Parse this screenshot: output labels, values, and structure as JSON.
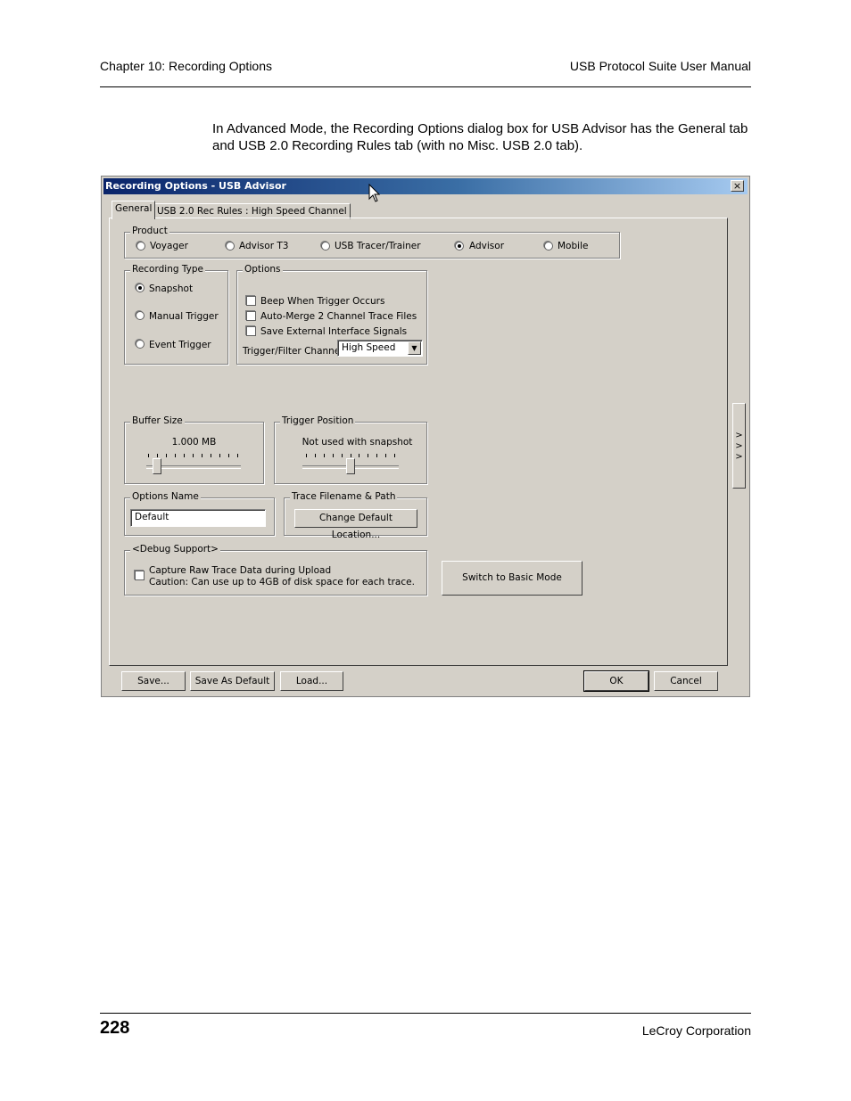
{
  "page": {
    "header_left": "Chapter 10: Recording Options",
    "header_right": "USB Protocol Suite User Manual",
    "intro": "In Advanced Mode, the Recording Options dialog box for USB Advisor has the General tab and USB 2.0 Recording Rules tab (with no Misc. USB 2.0 tab).",
    "page_number": "228",
    "footer_right": "LeCroy Corporation"
  },
  "dialog": {
    "title": "Recording Options - USB Advisor",
    "close_glyph": "×",
    "tabs": [
      "General",
      "USB 2.0 Rec Rules : High Speed Channel"
    ],
    "product": {
      "legend": "Product",
      "options": [
        "Voyager",
        "Advisor T3",
        "USB Tracer/Trainer",
        "Advisor",
        "Mobile"
      ],
      "selected": "Advisor"
    },
    "recording_type": {
      "legend": "Recording Type",
      "options": [
        "Snapshot",
        "Manual Trigger",
        "Event Trigger"
      ],
      "selected": "Snapshot"
    },
    "options": {
      "legend": "Options",
      "checkboxes": [
        "Beep When Trigger Occurs",
        "Auto-Merge 2 Channel Trace Files",
        "Save External Interface Signals"
      ],
      "channel_label": "Trigger/Filter Channel:",
      "channel_value": "High Speed",
      "dropdown_arrow": "▼"
    },
    "buffer_size": {
      "legend": "Buffer Size",
      "value": "1.000 MB",
      "slider_level": 0.1
    },
    "trigger_position": {
      "legend": "Trigger Position",
      "value": "Not used with snapshot",
      "slider_level": 0.5
    },
    "options_name": {
      "legend": "Options Name",
      "value": "Default"
    },
    "trace_filename": {
      "legend": "Trace Filename & Path",
      "button": "Change Default Location..."
    },
    "debug": {
      "legend": "<Debug Support>",
      "line1": "Capture Raw Trace Data during Upload",
      "line2": "Caution: Can use up to 4GB of disk space for each trace."
    },
    "switch_button": "Switch to Basic Mode",
    "side_button": ">\n>\n>",
    "bottom_buttons": {
      "save": "Save...",
      "save_default": "Save As Default",
      "load": "Load...",
      "ok": "OK",
      "cancel": "Cancel"
    }
  }
}
